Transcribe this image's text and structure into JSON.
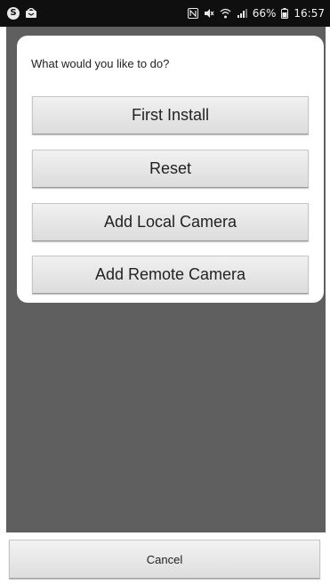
{
  "status_bar": {
    "left_icons": [
      "skype-icon",
      "notification-icon"
    ],
    "right_icons": [
      "nfc-icon",
      "mute-icon",
      "wifi-icon",
      "signal-icon",
      "battery-icon"
    ],
    "battery_percent": "66%",
    "time": "16:57"
  },
  "dialog": {
    "title": "What would you like to do?",
    "options": [
      {
        "label": "First Install"
      },
      {
        "label": "Reset"
      },
      {
        "label": "Add Local Camera"
      },
      {
        "label": "Add Remote Camera"
      }
    ]
  },
  "footer": {
    "cancel_label": "Cancel"
  },
  "colors": {
    "status_bar_bg": "#0f0f0f",
    "overlay_bg": "#5f5f5f",
    "dialog_bg": "#ffffff",
    "button_bg": "#e6e6e6",
    "text": "#222222"
  }
}
